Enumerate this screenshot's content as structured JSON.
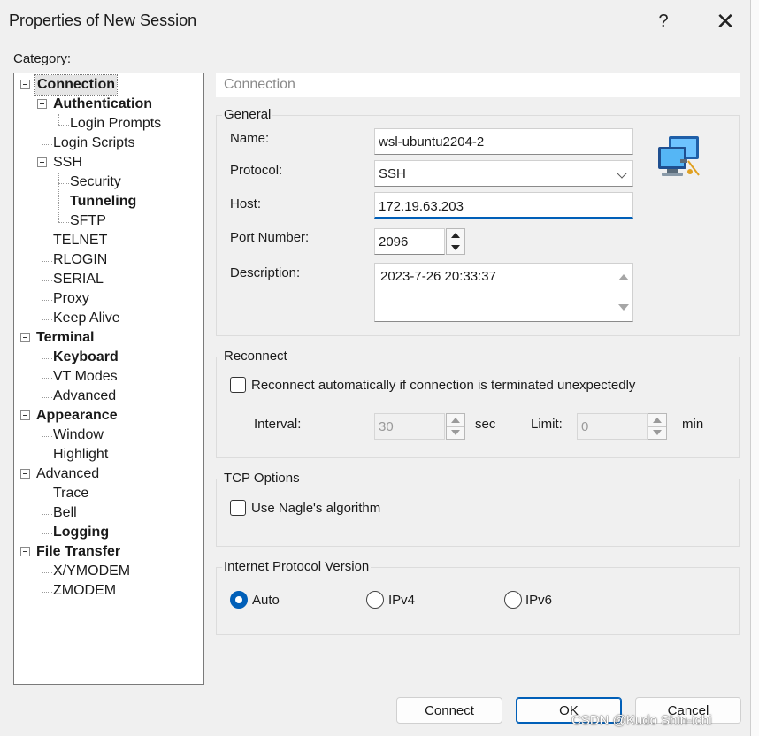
{
  "window": {
    "title": "Properties of New Session",
    "help_icon": "?",
    "close_icon": "✕"
  },
  "category": {
    "label": "Category:",
    "items": [
      {
        "label": "Connection"
      },
      {
        "label": "Authentication"
      },
      {
        "label": "Login Prompts"
      },
      {
        "label": "Login Scripts"
      },
      {
        "label": "SSH"
      },
      {
        "label": "Security"
      },
      {
        "label": "Tunneling"
      },
      {
        "label": "SFTP"
      },
      {
        "label": "TELNET"
      },
      {
        "label": "RLOGIN"
      },
      {
        "label": "SERIAL"
      },
      {
        "label": "Proxy"
      },
      {
        "label": "Keep Alive"
      },
      {
        "label": "Terminal"
      },
      {
        "label": "Keyboard"
      },
      {
        "label": "VT Modes"
      },
      {
        "label": "Advanced"
      },
      {
        "label": "Appearance"
      },
      {
        "label": "Window"
      },
      {
        "label": "Highlight"
      },
      {
        "label": "Advanced"
      },
      {
        "label": "Trace"
      },
      {
        "label": "Bell"
      },
      {
        "label": "Logging"
      },
      {
        "label": "File Transfer"
      },
      {
        "label": "X/YMODEM"
      },
      {
        "label": "ZMODEM"
      }
    ]
  },
  "panel": {
    "header": "Connection",
    "general": {
      "title": "General",
      "name_label": "Name:",
      "name_value": "wsl-ubuntu2204-2",
      "protocol_label": "Protocol:",
      "protocol_value": "SSH",
      "host_label": "Host:",
      "host_value": "172.19.63.203",
      "port_label": "Port Number:",
      "port_value": "2096",
      "description_label": "Description:",
      "description_value": "2023-7-26 20:33:37"
    },
    "reconnect": {
      "title": "Reconnect",
      "checkbox_label": "Reconnect automatically if connection is terminated unexpectedly",
      "checked": false,
      "interval_label": "Interval:",
      "interval_value": "30",
      "interval_unit": "sec",
      "limit_label": "Limit:",
      "limit_value": "0",
      "limit_unit": "min"
    },
    "tcp": {
      "title": "TCP Options",
      "nagle_label": "Use Nagle's algorithm",
      "checked": false
    },
    "ip": {
      "title": "Internet Protocol Version",
      "options": [
        "Auto",
        "IPv4",
        "IPv6"
      ],
      "selected": "Auto"
    }
  },
  "buttons": {
    "connect": "Connect",
    "ok": "OK",
    "cancel": "Cancel"
  },
  "watermark": "CSDN @Kudo Shin-ichi",
  "colors": {
    "accent": "#005fb8",
    "dialog_bg": "#f0f0f0"
  }
}
